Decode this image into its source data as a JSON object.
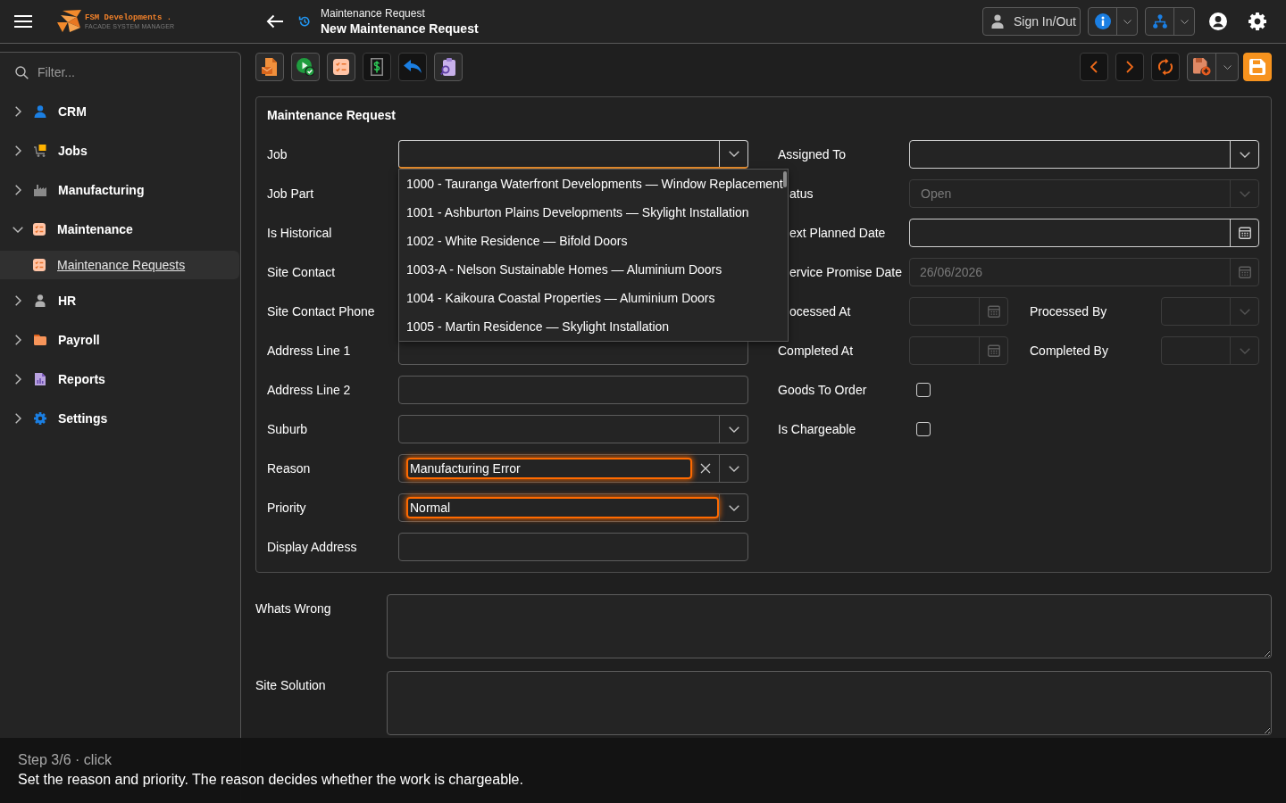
{
  "header": {
    "logo": {
      "name": "FSM Developments .",
      "tagline": "FACADE SYSTEM MANAGER"
    },
    "breadcrumb": "Maintenance Request",
    "title": "New Maintenance Request",
    "sign_in_button": "Sign In/Out"
  },
  "sidebar": {
    "filter": {
      "placeholder": "Filter..."
    },
    "items": [
      {
        "label": "CRM",
        "expanded": false,
        "selected": false
      },
      {
        "label": "Jobs",
        "expanded": false,
        "selected": false
      },
      {
        "label": "Manufacturing",
        "expanded": false,
        "selected": false
      },
      {
        "label": "Maintenance",
        "expanded": true,
        "selected": false,
        "children": [
          {
            "label": "Maintenance Requests",
            "selected": true
          }
        ]
      },
      {
        "label": "HR",
        "expanded": false,
        "selected": false
      },
      {
        "label": "Payroll",
        "expanded": false,
        "selected": false
      },
      {
        "label": "Reports",
        "expanded": false,
        "selected": false
      },
      {
        "label": "Settings",
        "expanded": false,
        "selected": false
      }
    ]
  },
  "form": {
    "title": "Maintenance Request",
    "left_fields": [
      {
        "label": "Job",
        "kind": "select",
        "expanded": true,
        "highlighted": false,
        "outlined": true,
        "clearable": false,
        "options": [
          "1000 - Tauranga Waterfront Developments — Window Replacement",
          "1001 - Ashburton Plains Developments — Skylight Installation",
          "1002 - White Residence — Bifold Doors",
          "1003-A - Nelson Sustainable Homes — Aluminium Doors",
          "1004 - Kaikoura Coastal Properties — Aluminium Doors",
          "1005 - Martin Residence — Skylight Installation"
        ]
      },
      {
        "label": "Job Part",
        "kind": "label"
      },
      {
        "label": "Is Historical",
        "kind": "label"
      },
      {
        "label": "Site Contact",
        "kind": "label"
      },
      {
        "label": "Site Contact Phone",
        "kind": "label"
      },
      {
        "label": "Address Line 1",
        "kind": "text",
        "highlighted": false,
        "outlined": false
      },
      {
        "label": "Address Line 2",
        "kind": "text",
        "highlighted": false,
        "outlined": false
      },
      {
        "label": "Suburb",
        "kind": "select",
        "expanded": false,
        "highlighted": false,
        "outlined": false,
        "clearable": false
      },
      {
        "label": "Reason",
        "kind": "select",
        "value": "Manufacturing Error",
        "expanded": false,
        "highlighted": true,
        "outlined": false,
        "clearable": true
      },
      {
        "label": "Priority",
        "kind": "select",
        "value": "Normal",
        "expanded": false,
        "highlighted": true,
        "outlined": false,
        "clearable": false
      },
      {
        "label": "Display Address",
        "kind": "text",
        "highlighted": false,
        "outlined": false
      }
    ],
    "right_fields": [
      {
        "label": "Assigned To",
        "kind": "select",
        "covered": false,
        "disabled": false,
        "outlined": true
      },
      {
        "label": "atus",
        "kind": "select",
        "value": "Open",
        "covered": true,
        "disabled": true,
        "outlined": false
      },
      {
        "label": "ext Planned Date",
        "kind": "date",
        "covered": true,
        "disabled": false,
        "outlined": true
      },
      {
        "label": "ervice Promise Date",
        "kind": "date",
        "value": "26/06/2026",
        "covered": true,
        "disabled": true,
        "outlined": false
      },
      {
        "label": "ocessed At",
        "kind": "pair",
        "second_label": "Processed By",
        "covered": true,
        "disabled": true,
        "outlined": false
      },
      {
        "label": "Completed At",
        "kind": "pair",
        "second_label": "Completed By",
        "covered": false,
        "disabled": true,
        "outlined": false
      },
      {
        "label": "Goods To Order",
        "kind": "checkbox",
        "checked": false
      },
      {
        "label": "Is Chargeable",
        "kind": "checkbox",
        "checked": false
      }
    ]
  },
  "notes": [
    {
      "label": "Whats Wrong"
    },
    {
      "label": "Site Solution"
    }
  ],
  "tutorial": {
    "step": "Step 3/6 · click",
    "text": "Set the reason and priority. The reason decides whether the work is chargeable."
  }
}
